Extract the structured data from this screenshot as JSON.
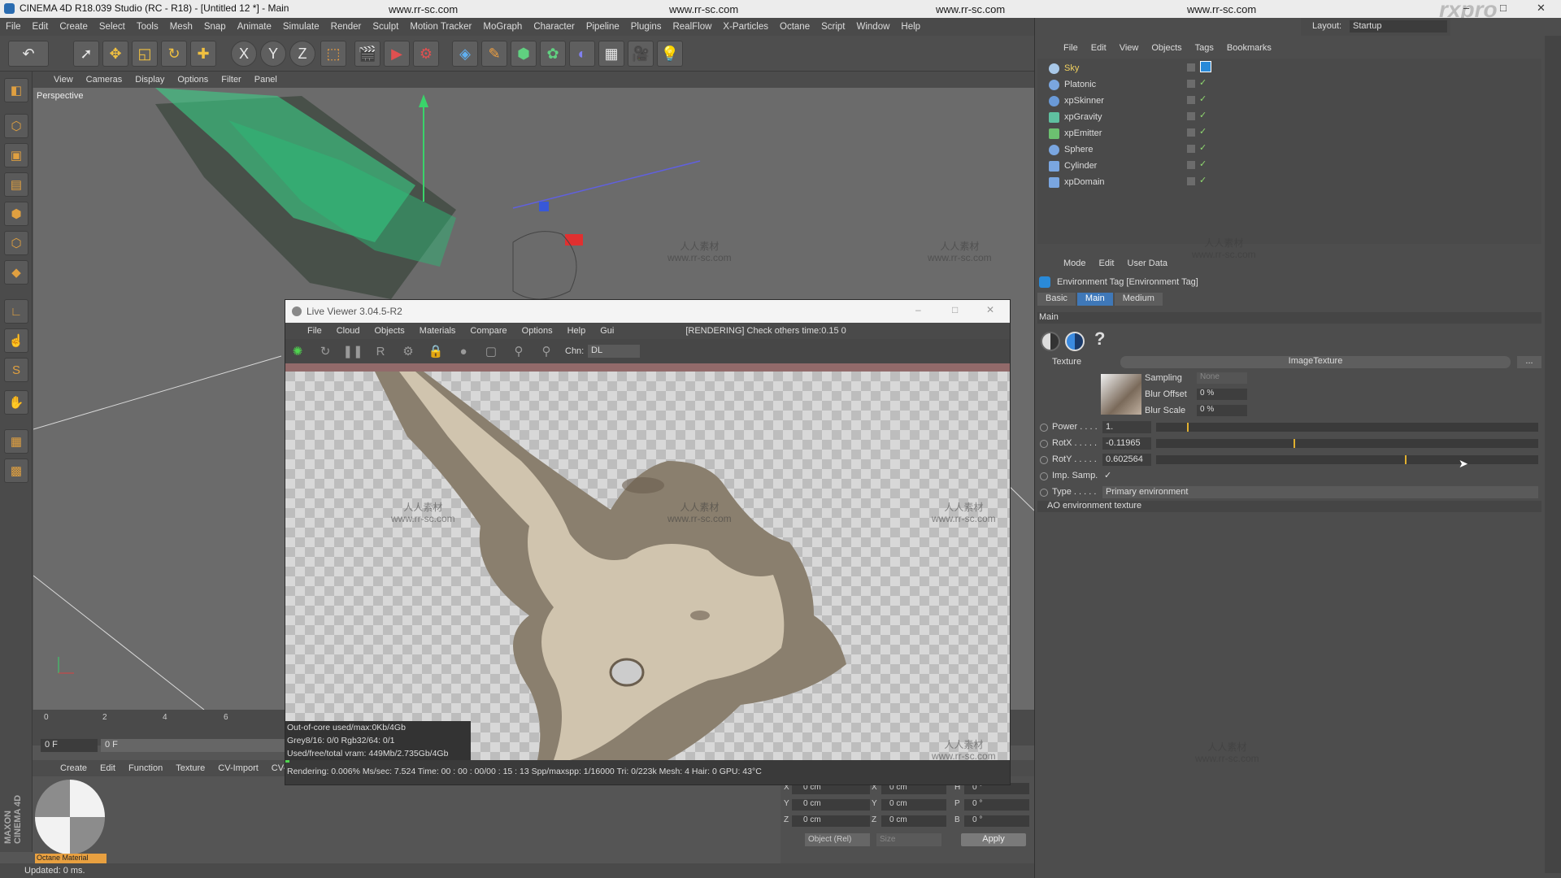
{
  "title_bar": {
    "title": "CINEMA 4D R18.039 Studio (RC - R18) - [Untitled 12 *] - Main",
    "watermarks": [
      "www.rr-sc.com",
      "www.rr-sc.com",
      "www.rr-sc.com",
      "www.rr-sc.com"
    ],
    "brand": "rxpro"
  },
  "main_menu": [
    "File",
    "Edit",
    "Create",
    "Select",
    "Tools",
    "Mesh",
    "Snap",
    "Animate",
    "Simulate",
    "Render",
    "Sculpt",
    "Motion Tracker",
    "MoGraph",
    "Character",
    "Pipeline",
    "Plugins",
    "RealFlow",
    "X-Particles",
    "Octane",
    "Script",
    "Window",
    "Help"
  ],
  "layout": {
    "label": "Layout:",
    "value": "Startup"
  },
  "toolbar_icons": [
    "undo-icon",
    "live-select-icon",
    "move-icon",
    "scale-icon",
    "rotate-icon",
    "transform-icon",
    "x-axis-icon",
    "y-axis-icon",
    "z-axis-icon",
    "coordinate-system-icon",
    "render-view-icon",
    "render-picture-viewer-icon",
    "render-settings-icon",
    "cube-icon",
    "pen-icon",
    "subdivision-icon",
    "cloner-icon",
    "deformer-icon",
    "floor-icon",
    "camera-icon",
    "light-icon"
  ],
  "axis_labels": [
    "X",
    "Y",
    "Z"
  ],
  "viewport": {
    "menu": [
      "View",
      "Cameras",
      "Display",
      "Options",
      "Filter",
      "Panel"
    ],
    "name": "Perspective",
    "timeline_ticks": [
      "0",
      "2",
      "4",
      "6"
    ],
    "frame_field": "0 F",
    "frame_field2": "0 F"
  },
  "material_manager": {
    "menu": [
      "Create",
      "Edit",
      "Function",
      "Texture",
      "CV-Import",
      "CV-S"
    ],
    "material_name": "Octane Material"
  },
  "coordinates": {
    "rows": [
      {
        "a": "X",
        "av": "0 cm",
        "b": "X",
        "bv": "0 cm",
        "c": "H",
        "cv": "0 °"
      },
      {
        "a": "Y",
        "av": "0 cm",
        "b": "Y",
        "bv": "0 cm",
        "c": "P",
        "cv": "0 °"
      },
      {
        "a": "Z",
        "av": "0 cm",
        "b": "Z",
        "bv": "0 cm",
        "c": "B",
        "cv": "0 °"
      }
    ],
    "mode_select": "Object (Rel)",
    "size_select": "Size",
    "apply": "Apply"
  },
  "status": {
    "text": "Updated: 0 ms."
  },
  "maxon_logo": "MAXON CINEMA 4D",
  "object_manager": {
    "menu": [
      "File",
      "Edit",
      "View",
      "Objects",
      "Tags",
      "Bookmarks"
    ],
    "objects": [
      {
        "name": "Sky",
        "color": "#a8c8e8",
        "selected": true
      },
      {
        "name": "Platonic",
        "color": "#7aa6e0",
        "selected": false
      },
      {
        "name": "xpSkinner",
        "color": "#6a9ad8",
        "selected": false
      },
      {
        "name": "xpGravity",
        "color": "#5fc0a0",
        "selected": false
      },
      {
        "name": "xpEmitter",
        "color": "#6cc070",
        "selected": false
      },
      {
        "name": "Sphere",
        "color": "#7aa6e0",
        "selected": false
      },
      {
        "name": "Cylinder",
        "color": "#7aa6e0",
        "selected": false
      },
      {
        "name": "xpDomain",
        "color": "#7aa6e0",
        "selected": false
      }
    ]
  },
  "attribute_manager": {
    "menu": [
      "Mode",
      "Edit",
      "User Data"
    ],
    "title": "Environment Tag [Environment Tag]",
    "tabs": [
      "Basic",
      "Main",
      "Medium"
    ],
    "active_tab": "Main",
    "section": "Main",
    "texture_label": "Texture",
    "texture_name": "ImageTexture",
    "texture_more": "...",
    "sampling_label": "Sampling",
    "sampling_value": "None",
    "blur_offset_label": "Blur Offset",
    "blur_offset_value": "0 %",
    "blur_scale_label": "Blur Scale",
    "blur_scale_value": "0 %",
    "params": [
      {
        "label": "Power . . . .",
        "value": "1.",
        "level": 0.08
      },
      {
        "label": "RotX . . . . .",
        "value": "-0.11965",
        "level": 0.36
      },
      {
        "label": "RotY . . . . .",
        "value": "0.602564",
        "level": 0.65
      }
    ],
    "imp_samp_label": "Imp. Samp.",
    "imp_samp_check": "✓",
    "type_label": "Type . . . . .",
    "type_value": "Primary environment",
    "ao_label": "AO environment texture"
  },
  "live_viewer": {
    "title": "Live Viewer 3.04.5-R2",
    "menu": [
      "File",
      "Cloud",
      "Objects",
      "Materials",
      "Compare",
      "Options",
      "Help",
      "Gui"
    ],
    "rendering_status": "[RENDERING] Check others time:0.15  0",
    "channel_label": "Chn:",
    "channel_value": "DL",
    "info_lines": [
      "Out-of-core used/max:0Kb/4Gb",
      "Grey8/16: 0/0          Rgb32/64: 0/1",
      "Used/free/total vram: 449Mb/2.735Gb/4Gb"
    ],
    "status_line": "Rendering: 0.006%   Ms/sec: 7.524   Time: 00 : 00 : 00/00 : 15 : 13   Spp/maxspp: 1/16000   Tri: 0/223k   Mesh: 4   Hair: 0   GPU:     43°C",
    "render_progress": 0.006
  },
  "watermark_cn": "人人素材",
  "watermark_url": "www.rr-sc.com"
}
